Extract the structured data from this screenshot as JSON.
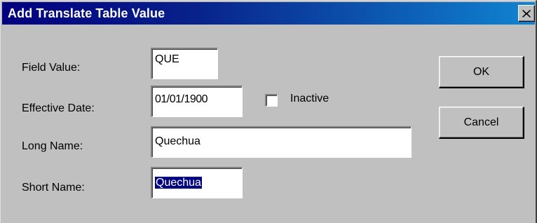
{
  "window": {
    "title": "Add Translate Table Value",
    "close_icon": "close-icon"
  },
  "form": {
    "field_value": {
      "label": "Field Value:",
      "value": "QUE"
    },
    "effective_date": {
      "label": "Effective Date:",
      "value": "01/01/1900"
    },
    "inactive": {
      "label": "Inactive",
      "checked": false
    },
    "long_name": {
      "label": "Long Name:",
      "value": "Quechua"
    },
    "short_name": {
      "label": "Short Name:",
      "value": "Quechua",
      "selected": true
    }
  },
  "buttons": {
    "ok_label": "OK",
    "cancel_label": "Cancel"
  },
  "colors": {
    "titlebar_start": "#000080",
    "titlebar_end": "#1084d0",
    "dialog_face": "#c0c0c0",
    "selection": "#000080"
  }
}
